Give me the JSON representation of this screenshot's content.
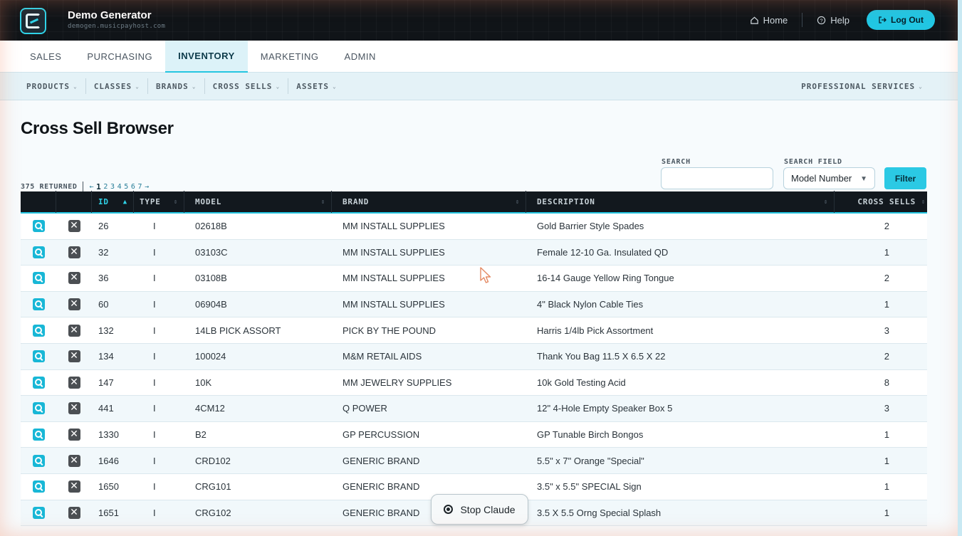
{
  "app": {
    "title": "Demo Generator",
    "subtitle": "demogen.musicpayhost.com"
  },
  "top_nav": {
    "home": "Home",
    "help": "Help",
    "logout": "Log Out"
  },
  "tabs": [
    {
      "label": "SALES",
      "active": false
    },
    {
      "label": "PURCHASING",
      "active": false
    },
    {
      "label": "INVENTORY",
      "active": true
    },
    {
      "label": "MARKETING",
      "active": false
    },
    {
      "label": "ADMIN",
      "active": false
    }
  ],
  "subnav": {
    "items": [
      "PRODUCTS",
      "CLASSES",
      "BRANDS",
      "CROSS SELLS",
      "ASSETS"
    ],
    "right": "PROFESSIONAL SERVICES"
  },
  "page": {
    "title": "Cross Sell Browser"
  },
  "search": {
    "label": "SEARCH",
    "value": "",
    "field_label": "SEARCH FIELD",
    "field_value": "Model Number",
    "filter_label": "Filter"
  },
  "results": {
    "returned": "375 RETURNED",
    "prev": "←",
    "next": "→",
    "pages": [
      "1",
      "2",
      "3",
      "4",
      "5",
      "6",
      "7"
    ],
    "current_page": "1"
  },
  "table": {
    "columns": [
      "ID",
      "TYPE",
      "MODEL",
      "BRAND",
      "DESCRIPTION",
      "CROSS SELLS"
    ],
    "sort_arrow": "▲",
    "sort_neutral": "⇕",
    "rows": [
      {
        "id": "26",
        "type": "I",
        "model": "02618B",
        "brand": "MM INSTALL SUPPLIES",
        "description": "Gold Barrier Style Spades",
        "cross_sells": "2"
      },
      {
        "id": "32",
        "type": "I",
        "model": "03103C",
        "brand": "MM INSTALL SUPPLIES",
        "description": "Female 12-10 Ga. Insulated QD",
        "cross_sells": "1"
      },
      {
        "id": "36",
        "type": "I",
        "model": "03108B",
        "brand": "MM INSTALL SUPPLIES",
        "description": "16-14 Gauge Yellow Ring Tongue",
        "cross_sells": "2"
      },
      {
        "id": "60",
        "type": "I",
        "model": "06904B",
        "brand": "MM INSTALL SUPPLIES",
        "description": "4\" Black Nylon Cable Ties",
        "cross_sells": "1"
      },
      {
        "id": "132",
        "type": "I",
        "model": "14LB PICK ASSORT",
        "brand": "PICK BY THE POUND",
        "description": "Harris 1/4lb Pick Assortment",
        "cross_sells": "3"
      },
      {
        "id": "134",
        "type": "I",
        "model": "100024",
        "brand": "M&M RETAIL AIDS",
        "description": "Thank You Bag 11.5 X 6.5 X 22",
        "cross_sells": "2"
      },
      {
        "id": "147",
        "type": "I",
        "model": "10K",
        "brand": "MM JEWELRY SUPPLIES",
        "description": "10k Gold Testing Acid",
        "cross_sells": "8"
      },
      {
        "id": "441",
        "type": "I",
        "model": "4CM12",
        "brand": "Q POWER",
        "description": "12\" 4-Hole Empty Speaker Box 5",
        "cross_sells": "3"
      },
      {
        "id": "1330",
        "type": "I",
        "model": "B2",
        "brand": "GP PERCUSSION",
        "description": "GP Tunable Birch Bongos",
        "cross_sells": "1"
      },
      {
        "id": "1646",
        "type": "I",
        "model": "CRD102",
        "brand": "GENERIC BRAND",
        "description": "5.5\" x 7\" Orange \"Special\"",
        "cross_sells": "1"
      },
      {
        "id": "1650",
        "type": "I",
        "model": "CRG101",
        "brand": "GENERIC BRAND",
        "description": "3.5\" x 5.5\" SPECIAL Sign",
        "cross_sells": "1"
      },
      {
        "id": "1651",
        "type": "I",
        "model": "CRG102",
        "brand": "GENERIC BRAND",
        "description": "3.5 X 5.5 Orng Special Splash",
        "cross_sells": "1"
      }
    ]
  },
  "overlay": {
    "stop_label": "Stop Claude"
  },
  "colors": {
    "accent": "#21c6e3",
    "header_bg": "#101418",
    "table_header_bg": "#12181e"
  }
}
